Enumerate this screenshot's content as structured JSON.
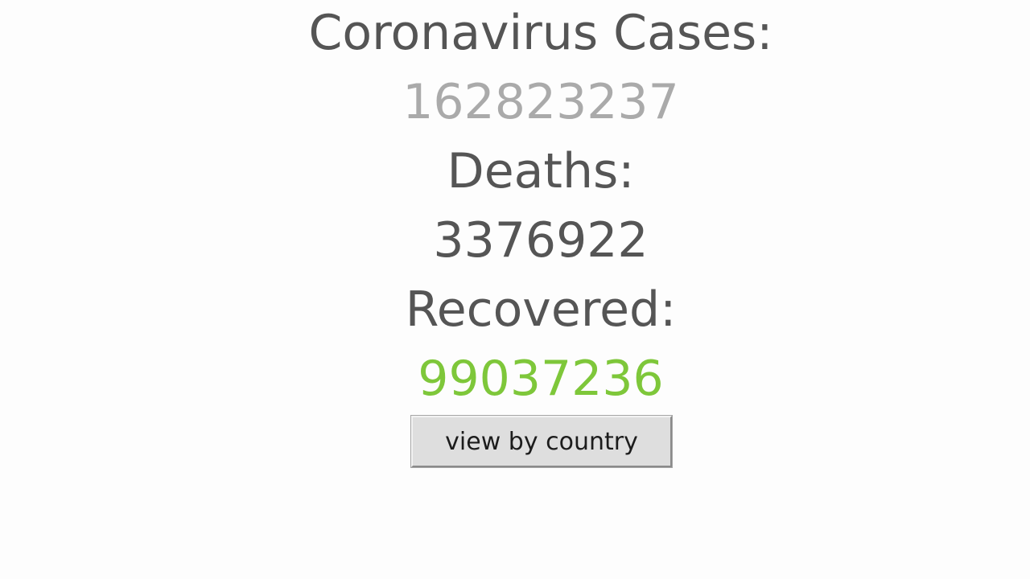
{
  "stats": {
    "cases_label": "Coronavirus Cases:",
    "cases_value": "162823237",
    "deaths_label": "Deaths:",
    "deaths_value": "3376922",
    "recovered_label": "Recovered:",
    "recovered_value": "99037236"
  },
  "colors": {
    "label": "#555555",
    "cases": "#aaaaaa",
    "deaths": "#555555",
    "recovered": "#7ec73a"
  },
  "actions": {
    "view_by_country_label": "view by country"
  }
}
